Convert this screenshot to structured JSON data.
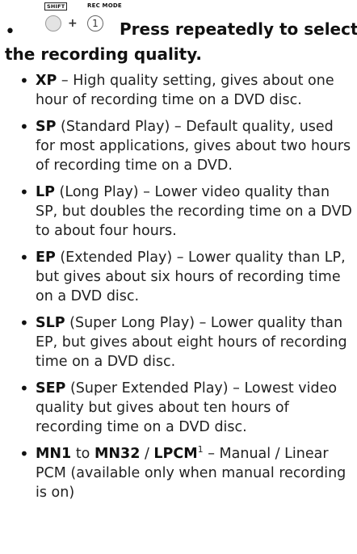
{
  "header": {
    "bullet": "•",
    "shift_label": "SHIFT",
    "recmode_label": "REC MODE",
    "plus": "+",
    "rec_button_glyph": "1",
    "intro_line1": "Press repeatedly to select",
    "intro_line2": "the recording quality."
  },
  "items": [
    {
      "term": "XP",
      "rest": " – High quality setting, gives about one hour of recording time on a DVD disc."
    },
    {
      "term": "SP",
      "rest": " (Standard Play) – Default quality, used for most applications, gives about two hours of recording time on a DVD."
    },
    {
      "term": "LP",
      "rest": " (Long Play) – Lower video quality than SP, but doubles the recording time on a DVD to about four hours."
    },
    {
      "term": "EP",
      "rest": " (Extended Play) – Lower quality than LP, but gives about six hours of recording time on a DVD disc."
    },
    {
      "term": "SLP",
      "rest": " (Super Long Play) – Lower quality than EP, but gives about eight hours of recording time on a DVD disc."
    },
    {
      "term": "SEP",
      "rest": " (Super Extended Play) – Lowest video quality but gives about ten hours of recording time on a DVD disc."
    }
  ],
  "last_item": {
    "term1": "MN1",
    "to": " to ",
    "term2": "MN32",
    "slash": " / ",
    "term3": "LPCM",
    "footnote": "1",
    "rest": " – Manual / Linear PCM (available only when manual recording is on)"
  }
}
